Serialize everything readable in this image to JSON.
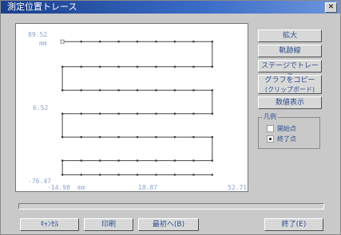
{
  "window": {
    "title": "測定位置トレース",
    "close_label": "✕"
  },
  "chart_data": {
    "type": "line",
    "title": "",
    "xlabel": "",
    "ylabel": "",
    "x_unit": "mm",
    "y_unit": "mm",
    "xlim": [
      -14.98,
      52.71
    ],
    "ylim": [
      -76.47,
      89.52
    ],
    "x_ticks": [
      "-14.98",
      "18.87",
      "52.71"
    ],
    "y_ticks": [
      "89.52",
      "6.52",
      "-76.47"
    ],
    "x_cols": [
      -1.43,
      4.09,
      9.56,
      15.03,
      20.5,
      25.98,
      31.45,
      36.92,
      42.4
    ],
    "y_rows": [
      72.0,
      47.0,
      23.7,
      0.4,
      -22.8,
      -46.1,
      -60.2
    ],
    "path_shape": "serpentine"
  },
  "buttons": {
    "zoom": "拡大",
    "trajectory": "軌跡線",
    "stage_trace": "ステージでトレース",
    "copy_graph_line1": "グラフをコピー",
    "copy_graph_line2": "(クリップボード)",
    "show_values": "数値表示",
    "cancel": "ｷｬﾝｾﾙ",
    "print": "印刷",
    "first": "最初へ(B)",
    "exit": "終了(E)"
  },
  "legend": {
    "title": "凡例",
    "start": "開始点",
    "end": "終了点"
  }
}
